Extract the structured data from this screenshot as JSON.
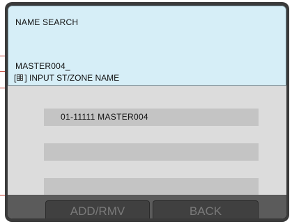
{
  "panel": {
    "title": "NAME SEARCH",
    "entry_text": "MASTER004_",
    "hint_prefix": "[",
    "hint_suffix": "] INPUT ST/ZONE NAME"
  },
  "results": [
    {
      "label": "01-11111 MASTER004"
    },
    {
      "label": ""
    },
    {
      "label": ""
    }
  ],
  "buttons": {
    "add_remove": "ADD/RMV",
    "back": "BACK"
  },
  "colors": {
    "panel_bg": "#d6eef7",
    "screen_bg": "#dcdcdc",
    "row_bg": "#c4c4c4",
    "bezel": "#3a3a3a",
    "button_text": "#7a7a7a",
    "leader_line": "#c0392b"
  },
  "icons": {
    "hint": "keyboard-icon"
  }
}
